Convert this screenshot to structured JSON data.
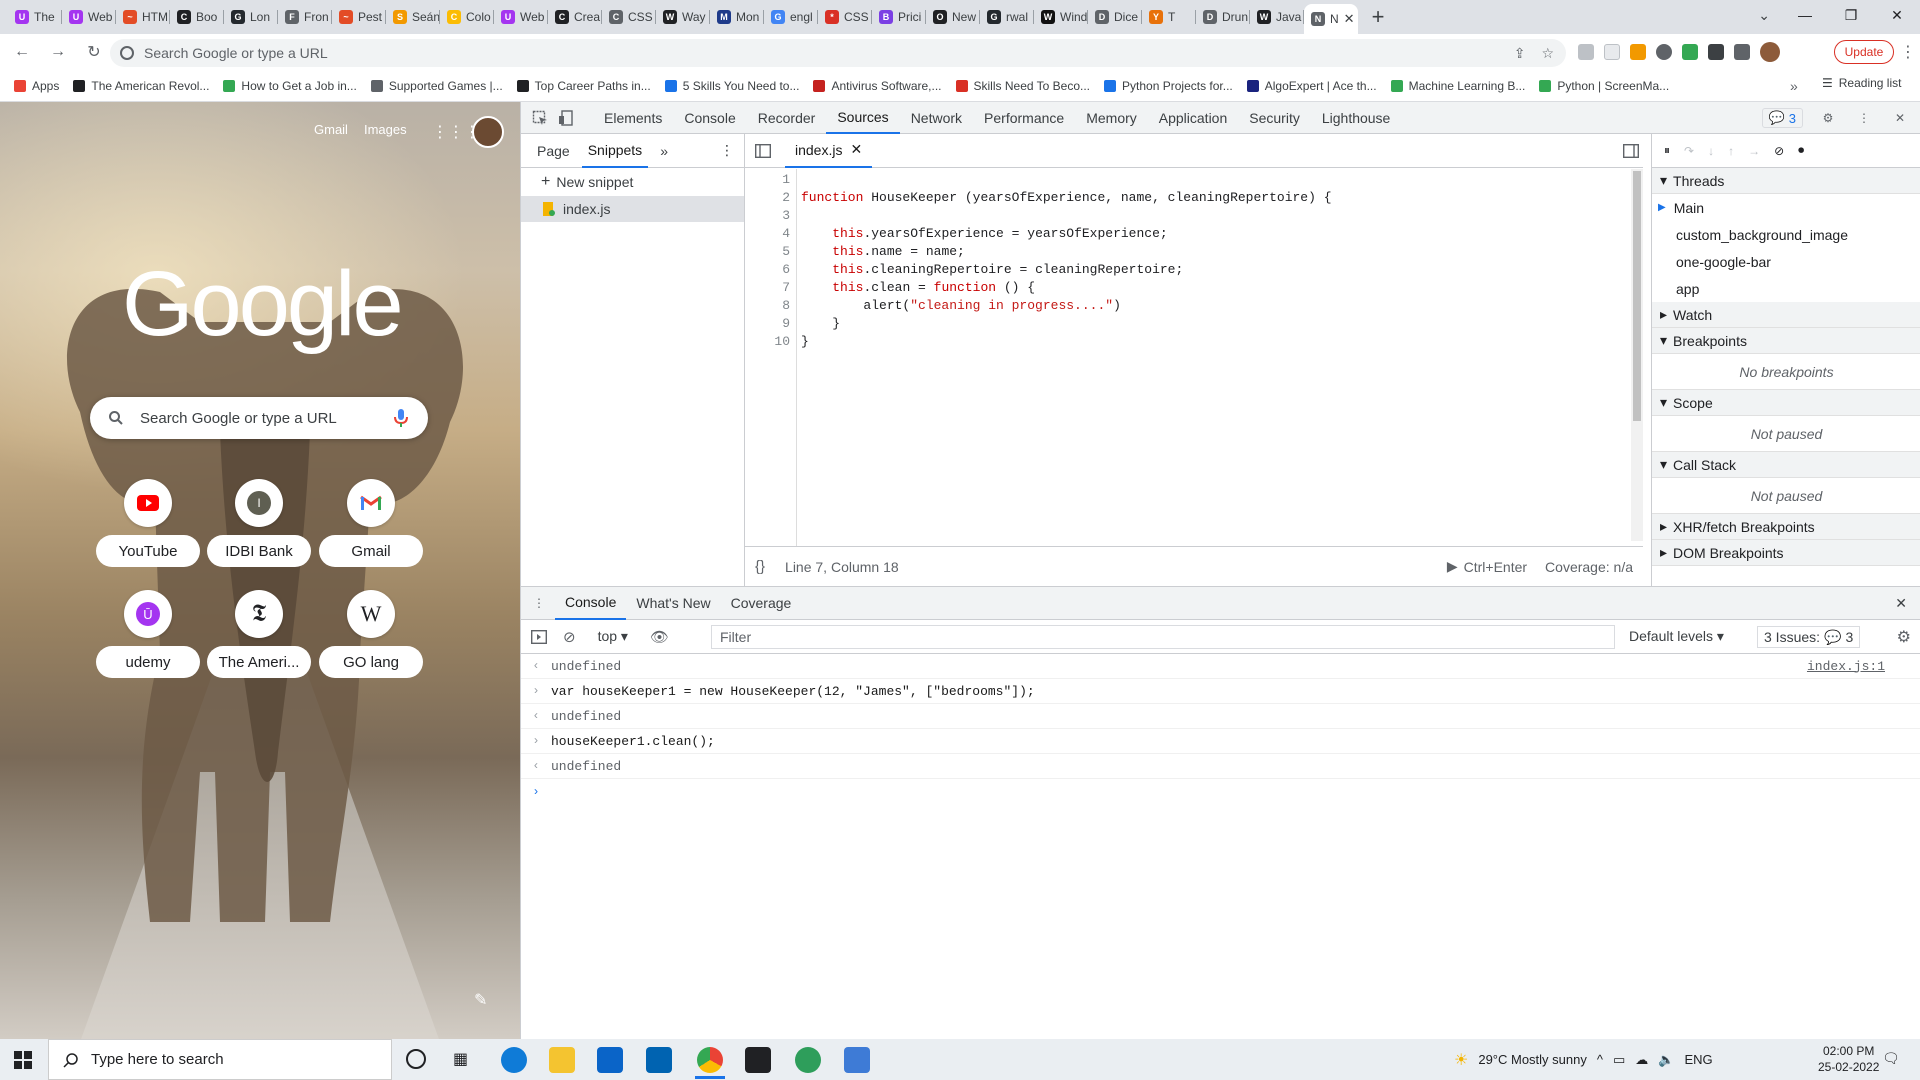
{
  "browser": {
    "tabs": [
      {
        "label": "The",
        "color": "#a435f0",
        "glyph": "U"
      },
      {
        "label": "Web",
        "color": "#a435f0",
        "glyph": "U"
      },
      {
        "label": "HTM",
        "color": "#e34c26",
        "glyph": "~"
      },
      {
        "label": "Boo",
        "color": "#202124",
        "glyph": "C"
      },
      {
        "label": "Lon",
        "color": "#24292e",
        "glyph": "G"
      },
      {
        "label": "Fron",
        "color": "#5f6368",
        "glyph": "F"
      },
      {
        "label": "Pest",
        "color": "#e34c26",
        "glyph": "~"
      },
      {
        "label": "Seán",
        "color": "#f29900",
        "glyph": "S"
      },
      {
        "label": "Colo",
        "color": "#fbbc04",
        "glyph": "C"
      },
      {
        "label": "Web",
        "color": "#a435f0",
        "glyph": "U"
      },
      {
        "label": "Crea",
        "color": "#202124",
        "glyph": "C"
      },
      {
        "label": "CSS",
        "color": "#5f6368",
        "glyph": "C"
      },
      {
        "label": "Way",
        "color": "#202124",
        "glyph": "W"
      },
      {
        "label": "Mon",
        "color": "#1e3a8a",
        "glyph": "M"
      },
      {
        "label": "engl",
        "color": "#4285f4",
        "glyph": "G"
      },
      {
        "label": "CSS",
        "color": "#d93025",
        "glyph": "*"
      },
      {
        "label": "Prici",
        "color": "#7b3fe4",
        "glyph": "B"
      },
      {
        "label": "New",
        "color": "#202124",
        "glyph": "O"
      },
      {
        "label": "rwal",
        "color": "#24292e",
        "glyph": "G"
      },
      {
        "label": "Wind",
        "color": "#111",
        "glyph": "W"
      },
      {
        "label": "Dice",
        "color": "#5f6368",
        "glyph": "D"
      },
      {
        "label": "T",
        "color": "#e8710a",
        "glyph": "Y"
      },
      {
        "label": "Drun",
        "color": "#5f6368",
        "glyph": "D"
      },
      {
        "label": "Java",
        "color": "#202124",
        "glyph": "W"
      },
      {
        "label": "N",
        "color": "#5f6368",
        "glyph": "N",
        "active": true
      }
    ],
    "omnibox_placeholder": "Search Google or type a URL",
    "update_label": "Update",
    "bookmarks": [
      {
        "label": "Apps",
        "color": "#ea4335"
      },
      {
        "label": "The American Revol...",
        "color": "#202124"
      },
      {
        "label": "How to Get a Job in...",
        "color": "#34a853"
      },
      {
        "label": "Supported Games |...",
        "color": "#5f6368"
      },
      {
        "label": "Top Career Paths in...",
        "color": "#202124"
      },
      {
        "label": "5 Skills You Need to...",
        "color": "#1a73e8"
      },
      {
        "label": "Antivirus Software,...",
        "color": "#c5221f"
      },
      {
        "label": "Skills Need To Beco...",
        "color": "#d93025"
      },
      {
        "label": "Python Projects for...",
        "color": "#1a73e8"
      },
      {
        "label": "AlgoExpert | Ace th...",
        "color": "#1a237e"
      },
      {
        "label": "Machine Learning B...",
        "color": "#34a853"
      },
      {
        "label": "Python | ScreenMa...",
        "color": "#34a853"
      }
    ],
    "reading_list": "Reading list"
  },
  "ntp": {
    "links": [
      "Gmail",
      "Images"
    ],
    "logo_text": "Google",
    "search_placeholder": "Search Google or type a URL",
    "shortcuts": [
      {
        "label": "YouTube",
        "icon": "youtube-icon"
      },
      {
        "label": "IDBI Bank",
        "icon": "idbi-icon"
      },
      {
        "label": "Gmail",
        "icon": "gmail-icon"
      },
      {
        "label": "udemy",
        "icon": "udemy-icon"
      },
      {
        "label": "The Ameri...",
        "icon": "nyt-icon"
      },
      {
        "label": "GO lang",
        "icon": "wikipedia-icon"
      }
    ]
  },
  "devtools": {
    "tabs": [
      "Elements",
      "Console",
      "Recorder",
      "Sources",
      "Network",
      "Performance",
      "Memory",
      "Application",
      "Security",
      "Lighthouse"
    ],
    "active_tab": "Sources",
    "issues_count": "3",
    "navigator_tabs": [
      "Page",
      "Snippets"
    ],
    "new_snippet": "New snippet",
    "snippet_file": "index.js",
    "editor_file": "index.js",
    "code_lines": [
      "",
      "function HouseKeeper (yearsOfExperience, name, cleaningRepertoire) {",
      "",
      "    this.yearsOfExperience = yearsOfExperience;",
      "    this.name = name;",
      "    this.cleaningRepertoire = cleaningRepertoire;",
      "    this.clean = function () {",
      "        alert(\"cleaning in progress....\")",
      "    }",
      "}"
    ],
    "status_position": "Line 7, Column 18",
    "status_run": "Ctrl+Enter",
    "status_coverage": "Coverage: n/a",
    "threads_label": "Threads",
    "threads": [
      "Main",
      "custom_background_image",
      "one-google-bar",
      "app"
    ],
    "watch_label": "Watch",
    "breakpoints_label": "Breakpoints",
    "no_breakpoints": "No breakpoints",
    "scope_label": "Scope",
    "scope_empty": "Not paused",
    "callstack_label": "Call Stack",
    "callstack_empty": "Not paused",
    "xhr_label": "XHR/fetch Breakpoints",
    "dom_label": "DOM Breakpoints",
    "drawer_tabs": [
      "Console",
      "What's New",
      "Coverage"
    ],
    "context": "top",
    "filter_placeholder": "Filter",
    "levels": "Default levels",
    "issues_label": "3 Issues:",
    "issues_count2": "3",
    "console": [
      {
        "kind": "result",
        "text": "undefined",
        "source": "index.js:1"
      },
      {
        "kind": "input",
        "text": "var houseKeeper1 = new HouseKeeper(12, \"James\", [\"bedrooms\"]);"
      },
      {
        "kind": "result",
        "text": "undefined"
      },
      {
        "kind": "input",
        "text": "houseKeeper1.clean();"
      },
      {
        "kind": "result",
        "text": "undefined"
      }
    ]
  },
  "taskbar": {
    "search_placeholder": "Type here to search",
    "weather": "29°C  Mostly sunny",
    "lang": "ENG",
    "time": "02:00 PM",
    "date": "25-02-2022"
  }
}
